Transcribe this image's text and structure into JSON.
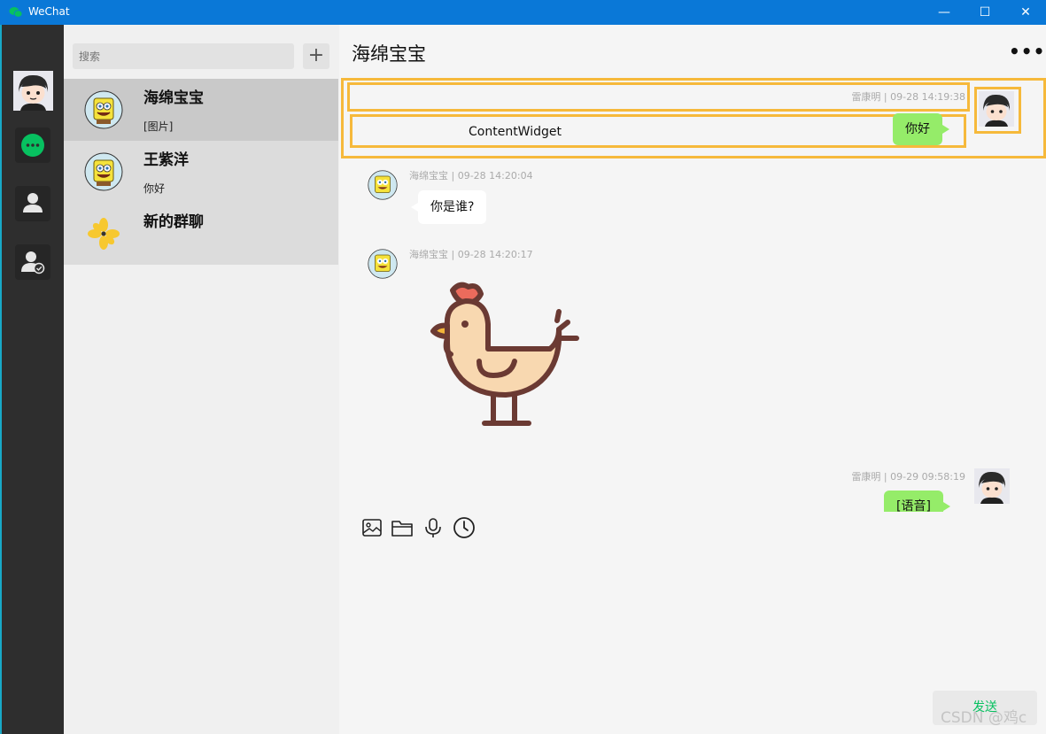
{
  "window": {
    "title": "WeChat",
    "minimize": "—",
    "maximize": "☐",
    "close": "✕"
  },
  "chatlist": {
    "search_placeholder": "搜索",
    "add_label": "+",
    "conversations": [
      {
        "name": "海绵宝宝",
        "last": "[图片]",
        "avatar": "spongebob-avatar"
      },
      {
        "name": "王紫洋",
        "last": "你好",
        "avatar": "spongebob-avatar"
      },
      {
        "name": "新的群聊",
        "last": "",
        "avatar": "flower-avatar"
      }
    ]
  },
  "chat": {
    "title": "海绵宝宝",
    "more": "•••",
    "messages": [
      {
        "meta": "雷康明 | 09-28 14:19:38",
        "text": "你好",
        "dir": "out",
        "debug_label": "ContentWidget"
      },
      {
        "meta": "海绵宝宝 | 09-28 14:20:04",
        "text": "你是谁?",
        "dir": "in"
      },
      {
        "meta": "海绵宝宝 | 09-28 14:20:17",
        "image": "chicken-sticker",
        "dir": "in"
      },
      {
        "meta": "雷康明 | 09-29 09:58:19",
        "text": "[语音]",
        "dir": "out"
      }
    ],
    "send_label": "发送"
  },
  "toolbar_icons": [
    "image-icon",
    "folder-icon",
    "microphone-icon",
    "clock-icon"
  ],
  "watermark": "CSDN @鸡c",
  "colors": {
    "titlebar": "#0a78d7",
    "sidebar": "#2e2e2e",
    "accent_green": "#07c160",
    "bubble_out": "#95ec69",
    "highlight": "#f6b93b"
  }
}
